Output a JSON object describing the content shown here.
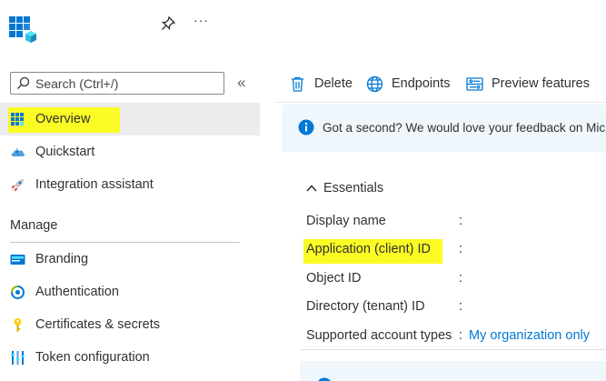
{
  "header": {
    "logo_icon": "app-registration-grid-icon",
    "pin_icon": "pin-icon",
    "more_label": "···"
  },
  "sidebar": {
    "search": {
      "placeholder": "Search (Ctrl+/)",
      "value": ""
    },
    "collapse_label": "«",
    "items": [
      {
        "label": "Overview",
        "icon": "overview-grid-icon",
        "selected": true,
        "highlighted": true
      },
      {
        "label": "Quickstart",
        "icon": "cloud-quickstart-icon"
      },
      {
        "label": "Integration assistant",
        "icon": "rocket-icon"
      }
    ],
    "manage_heading": "Manage",
    "manage_items": [
      {
        "label": "Branding",
        "icon": "branding-card-icon"
      },
      {
        "label": "Authentication",
        "icon": "authentication-icon"
      },
      {
        "label": "Certificates & secrets",
        "icon": "key-icon"
      },
      {
        "label": "Token configuration",
        "icon": "token-bars-icon"
      }
    ]
  },
  "toolbar": {
    "delete_label": "Delete",
    "endpoints_label": "Endpoints",
    "preview_label": "Preview features"
  },
  "banner": {
    "text": "Got a second? We would love your feedback on Micr",
    "icon": "info-icon"
  },
  "essentials": {
    "title": "Essentials",
    "rows": [
      {
        "label": "Display name",
        "colon": ":",
        "value": ""
      },
      {
        "label": "Application (client) ID",
        "colon": ":",
        "value": "",
        "highlighted": true
      },
      {
        "label": "Object ID",
        "colon": ":",
        "value": ""
      },
      {
        "label": "Directory (tenant) ID",
        "colon": ":",
        "value": ""
      },
      {
        "label": "Supported account types",
        "colon": ":",
        "value": "My organization only"
      }
    ]
  },
  "colors": {
    "accent": "#0078d4",
    "highlight": "#fbfb25",
    "selected_bg": "#ececec",
    "banner_bg": "#eff6fc"
  }
}
